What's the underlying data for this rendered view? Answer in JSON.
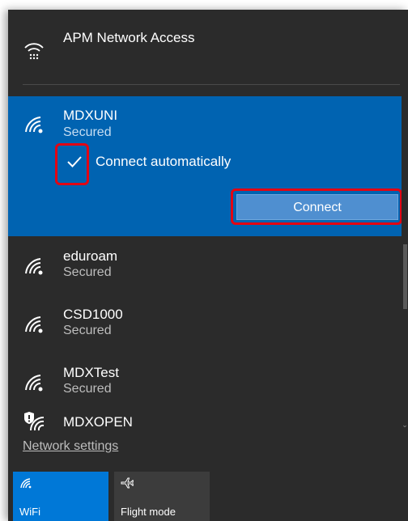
{
  "networks": [
    {
      "name": "APM Network Access",
      "status": "",
      "icon": "vpn-icon"
    },
    {
      "name": "MDXUNI",
      "status": "Secured",
      "icon": "wifi-secured-icon"
    },
    {
      "name": "eduroam",
      "status": "Secured",
      "icon": "wifi-secured-icon"
    },
    {
      "name": "CSD1000",
      "status": "Secured",
      "icon": "wifi-secured-icon"
    },
    {
      "name": "MDXTest",
      "status": "Secured",
      "icon": "wifi-secured-icon"
    },
    {
      "name": "MDXOPEN",
      "status": "",
      "icon": "wifi-open-shield-icon"
    }
  ],
  "selected_network": {
    "connect_automatically_label": "Connect automatically",
    "connect_automatically_checked": true,
    "connect_button_label": "Connect"
  },
  "footer": {
    "network_settings_label": "Network settings"
  },
  "quick_actions": [
    {
      "label": "WiFi",
      "icon": "wifi-icon",
      "active": true
    },
    {
      "label": "Flight mode",
      "icon": "airplane-icon",
      "active": false
    }
  ],
  "colors": {
    "accent": "#0063b1",
    "tile_active": "#0078d7",
    "highlight": "#e30613",
    "flyout_bg": "#2b2b2b"
  }
}
